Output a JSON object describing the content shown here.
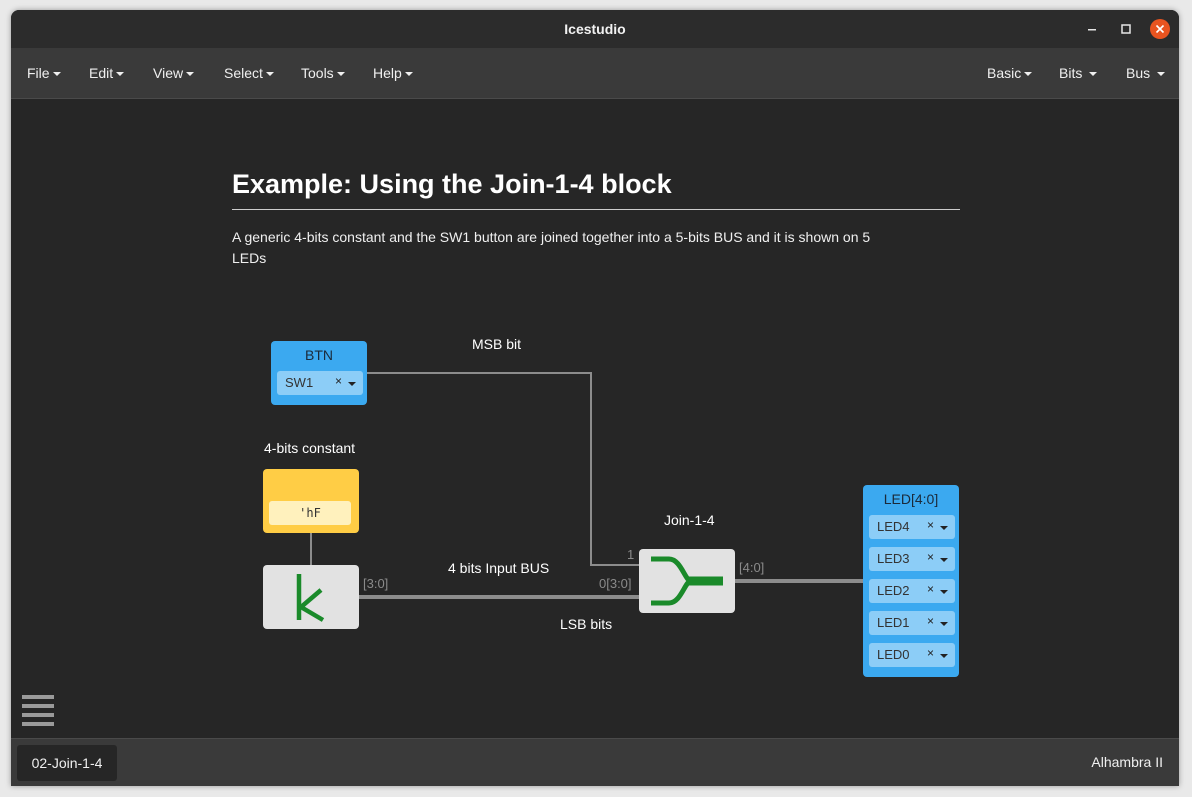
{
  "window": {
    "title": "Icestudio"
  },
  "menubar": {
    "left": [
      "File",
      "Edit",
      "View",
      "Select",
      "Tools",
      "Help"
    ],
    "right": [
      "Basic",
      "Bits",
      "Bus"
    ]
  },
  "info": {
    "title": "Example: Using the Join-1-4 block",
    "description": "A generic 4-bits constant and the SW1 button are joined together into a 5-bits BUS and it is shown on 5 LEDs"
  },
  "labels": {
    "msb": "MSB bit",
    "const_label": "4-bits constant",
    "input_bus": "4 bits Input BUS",
    "lsb": "LSB bits",
    "join_label": "Join-1-4"
  },
  "btn_block": {
    "name": "BTN",
    "pin": "SW1",
    "clear": "×"
  },
  "const_block": {
    "value": "'hF"
  },
  "k_block": {
    "glyph": "k"
  },
  "ports": {
    "k_out": "[3:0]",
    "join_in1": "1",
    "join_in0": "0[3:0]",
    "join_out": "[4:0]"
  },
  "led_block": {
    "name": "LED[4:0]",
    "pins": [
      "LED4",
      "LED3",
      "LED2",
      "LED1",
      "LED0"
    ],
    "clear": "×"
  },
  "footer": {
    "tab": "02-Join-1-4",
    "board": "Alhambra II"
  },
  "colors": {
    "io_block": "#3ba9f0",
    "constant_block": "#ffcd45",
    "generic_block": "#e2e2e2",
    "accent_green": "#1a8a2a",
    "close_button": "#e95420"
  }
}
